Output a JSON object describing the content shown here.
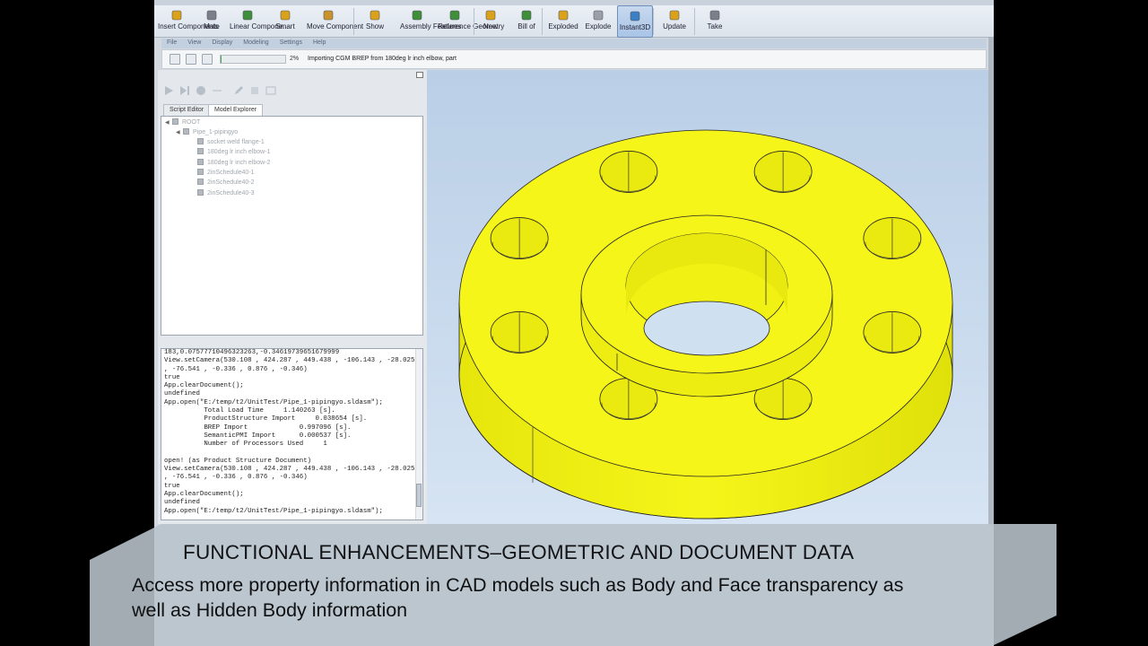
{
  "ribbon": {
    "buttons": [
      {
        "name": "insert-components-button",
        "label": "Insert Components",
        "icon": "insert-icon",
        "color": "#d9a21a"
      },
      {
        "name": "mate-button",
        "label": "Mate",
        "icon": "mate-icon",
        "color": "#7a7f8a"
      },
      {
        "name": "linear-component-button",
        "label": "Linear Compone...",
        "icon": "linear-pattern-icon",
        "color": "#3f8f3a"
      },
      {
        "name": "smart-button",
        "label": "Smart",
        "icon": "smart-icon",
        "color": "#d9a21a"
      },
      {
        "name": "move-component-button",
        "label": "Move Component",
        "icon": "move-icon",
        "color": "#c9922a"
      },
      {
        "name": "show-button",
        "label": "Show",
        "icon": "show-icon",
        "color": "#d9a21a"
      },
      {
        "name": "assembly-features-button",
        "label": "Assembly Features",
        "icon": "assembly-icon",
        "color": "#3f8f3a"
      },
      {
        "name": "reference-geometry-button",
        "label": "Reference Geometry",
        "icon": "reference-icon",
        "color": "#3f8f3a"
      },
      {
        "name": "new-button",
        "label": "New",
        "icon": "new-icon",
        "color": "#d9a21a"
      },
      {
        "name": "bill-of-materials-button",
        "label": "Bill of",
        "icon": "bom-icon",
        "color": "#3f8f3a"
      },
      {
        "name": "exploded-button",
        "label": "Exploded",
        "icon": "exploded-icon",
        "color": "#d9a21a"
      },
      {
        "name": "explode-button",
        "label": "Explode",
        "icon": "explode-icon",
        "color": "#9aa0a8"
      },
      {
        "name": "instant3d-button",
        "label": "Instant3D",
        "icon": "instant3d-icon",
        "color": "#3b7fc4"
      },
      {
        "name": "update-button",
        "label": "Update",
        "icon": "update-icon",
        "color": "#d9a21a"
      },
      {
        "name": "take-button",
        "label": "Take",
        "icon": "take-icon",
        "color": "#7a7f8a"
      }
    ]
  },
  "menubar": [
    "File",
    "View",
    "Display",
    "Modeling",
    "Settings",
    "Help"
  ],
  "importbar": {
    "progress_percent": 2,
    "progress_label": "2%",
    "message": "Importing CGM BREP from 180deg lr inch elbow, part"
  },
  "tabs": [
    "Script Editor",
    "Model Explorer"
  ],
  "tree": {
    "root": "ROOT",
    "assembly": "Pipe_1-pipingyo",
    "children": [
      "socket weld flange-1",
      "180deg lr inch elbow-1",
      "180deg lr inch elbow-2",
      "2inSchedule40-1",
      "2inSchedule40-2",
      "2inSchedule40-3"
    ]
  },
  "console": {
    "lines": [
      "183,0.07577710496323263,-0.34619739651679999",
      "View.setCamera(530.108 , 424.287 , 449.438 , -106.143 , -28.025",
      ", -76.541 , -0.336 , 0.876 , -0.346)",
      "true",
      "App.clearDocument();",
      "undefined",
      "App.open(\"E:/temp/t2/UnitTest/Pipe_1-pipingyo.sldasm\");",
      "          Total Load Time     1.140263 [s].",
      "          ProductStructure Import     0.038654 [s].",
      "          BREP Import             0.997096 [s].",
      "          SemanticPMI Import      0.000537 [s].",
      "          Number of Processors Used     1",
      "",
      "open! (as Product Structure Document)",
      "View.setCamera(530.108 , 424.287 , 449.438 , -106.143 , -28.025",
      ", -76.541 , -0.336 , 0.876 , -0.346)",
      "true",
      "App.clearDocument();",
      "undefined",
      "App.open(\"E:/temp/t2/UnitTest/Pipe_1-pipingyo.sldasm\");"
    ]
  },
  "viewport": {
    "model_color": "#f5f51a",
    "bolt_hole_count": 8
  },
  "caption": {
    "title": "FUNCTIONAL ENHANCEMENTS–GEOMETRIC AND DOCUMENT DATA",
    "body": "Access more property information in CAD models such as Body and Face transparency as well as Hidden Body information",
    "panel_color": "#b9c4cc"
  }
}
